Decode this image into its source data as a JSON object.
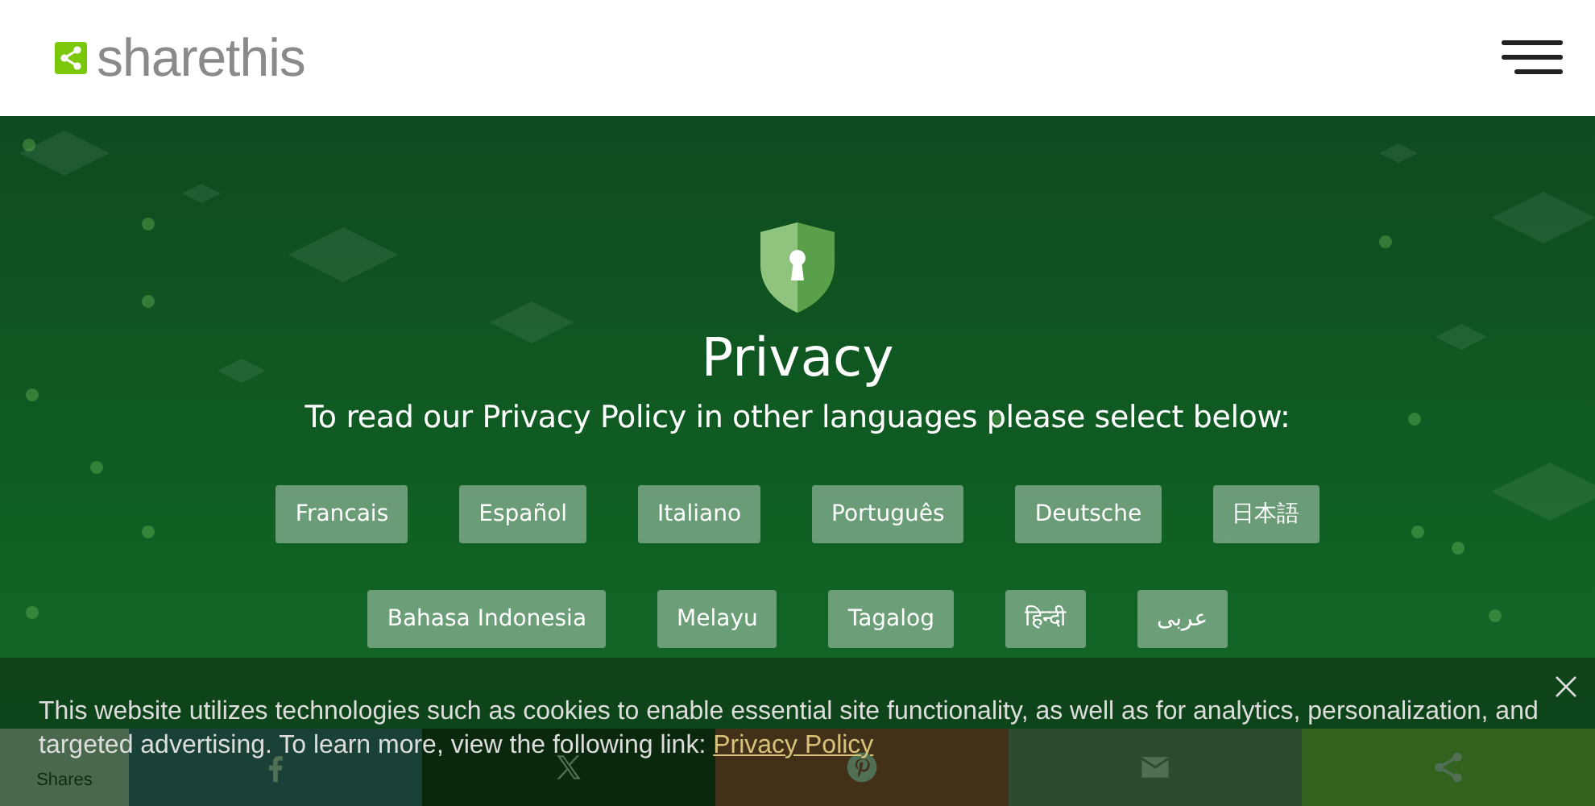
{
  "header": {
    "logo_text": "sharethis"
  },
  "hero": {
    "title": "Privacy",
    "subtitle": "To read our Privacy Policy in other languages please select below:"
  },
  "language_rows": [
    [
      "Francais",
      "Español",
      "Italiano",
      "Português",
      "Deutsche",
      "日本語"
    ],
    [
      "Bahasa Indonesia",
      "Melayu",
      "Tagalog",
      "हिन्दी",
      "عربى"
    ]
  ],
  "share_bar": {
    "count_label": "Shares",
    "buttons": [
      {
        "kind": "facebook"
      },
      {
        "kind": "x"
      },
      {
        "kind": "pinterest"
      },
      {
        "kind": "email"
      },
      {
        "kind": "share"
      }
    ]
  },
  "cookie_banner": {
    "text": "This website utilizes technologies such as cookies to enable essential site functionality, as well as for analytics, personalization, and targeted advertising. To learn more, view the following link:",
    "link": "Privacy Policy"
  }
}
